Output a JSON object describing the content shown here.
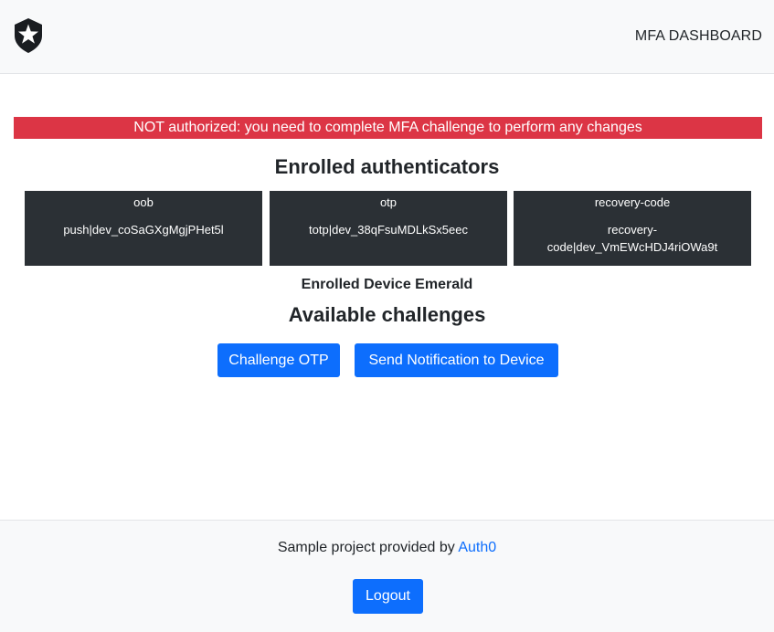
{
  "navbar": {
    "logo_icon": "auth0-star-shield-icon",
    "dashboard_link": "MFA DASHBOARD"
  },
  "alert": {
    "message": "NOT authorized: you need to complete MFA challenge to perform any changes",
    "color": "#dc3545"
  },
  "enrolled": {
    "title": "Enrolled authenticators",
    "authenticators": [
      {
        "type": "oob",
        "id": "push|dev_coSaGXgMgjPHet5l"
      },
      {
        "type": "otp",
        "id": "totp|dev_38qFsuMDLkSx5eec"
      },
      {
        "type": "recovery-code",
        "id": "recovery-code|dev_VmEWcHDJ4riOWa9t"
      }
    ],
    "device": "Enrolled Device Emerald"
  },
  "challenges": {
    "title": "Available challenges",
    "otp_button": "Challenge OTP",
    "push_button": "Send Notification to Device"
  },
  "footer": {
    "text": "Sample project provided by",
    "link_label": "Auth0",
    "logout_button": "Logout"
  },
  "colors": {
    "primary": "#0d6efd",
    "card_bg": "#2b3035",
    "navbar_bg": "#f8f9fa"
  }
}
